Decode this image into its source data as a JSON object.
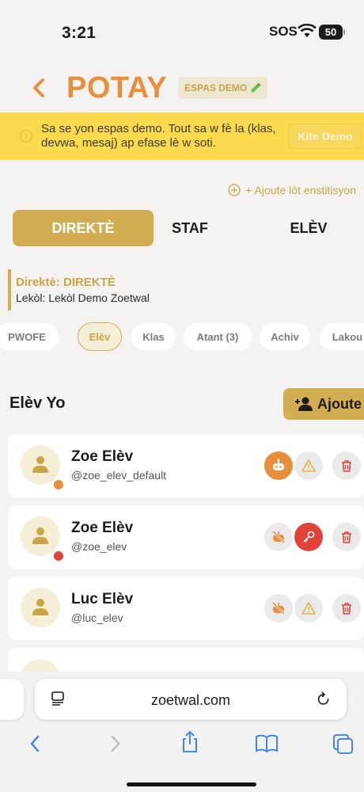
{
  "status_bar": {
    "time": "3:21",
    "sos": "SOS",
    "battery": "50"
  },
  "header": {
    "back_icon": "chevron-left-icon",
    "title": "POTAY",
    "demo_badge": "ESPAS DEMO",
    "badge_icon": "test-tube-icon"
  },
  "banner": {
    "icon": "info-icon",
    "text": "Sa se yon espas demo. Tout sa w fè la (klas, devwa, mesaj) ap efase lè w soti.",
    "exit_label": "Kite Demo"
  },
  "add_institution": {
    "icon": "plus-circle-icon",
    "label": "+ Ajoute lòt enstitisyon"
  },
  "role_tabs": [
    {
      "label": "DIREKTÈ",
      "active": true
    },
    {
      "label": "STAF",
      "active": false
    },
    {
      "label": "ELÈV",
      "active": false
    }
  ],
  "director": {
    "name": "Direktè: DIREKTÈ",
    "school": "Lekòl: Lekòl Demo Zoetwal"
  },
  "sections": [
    {
      "label": "PWOFE",
      "active": false
    },
    {
      "label": "Elèv",
      "active": true
    },
    {
      "label": "Klas",
      "active": false
    },
    {
      "label": "Atant (3)",
      "active": false
    },
    {
      "label": "Achiv",
      "active": false
    },
    {
      "label": "Lakou",
      "active": false
    }
  ],
  "students_section": {
    "title": "Elèv Yo",
    "add_label": "Ajoute",
    "add_icon": "add-user-icon"
  },
  "students": [
    {
      "name": "Zoe Elèv",
      "handle": "@zoe_elev_default"
    },
    {
      "name": "Zoe Elèv",
      "handle": "@zoe_elev"
    },
    {
      "name": "Luc Elèv",
      "handle": "@luc_elev"
    }
  ],
  "browser": {
    "url": "zoetwal.com"
  },
  "colors": {
    "accent": "#d2ad52",
    "title": "#e88f3c",
    "banner": "#fbdb4d",
    "danger": "#e0433a"
  }
}
